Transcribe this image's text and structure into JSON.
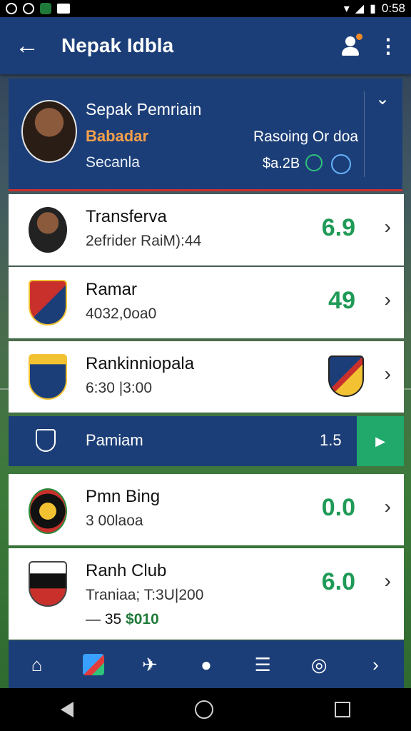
{
  "status_bar": {
    "time": "0:58"
  },
  "app_bar": {
    "title": "Nepak Idbla"
  },
  "profile": {
    "name": "Sepak Pemriain",
    "subtitle": "Babadar",
    "status": "Secanla",
    "rating_label": "Rasoing Or doa",
    "value": "$a.2B"
  },
  "rows": [
    {
      "title": "Transferva",
      "meta": "2efrider RaiM):44",
      "score": "6.9"
    },
    {
      "title": "Ramar",
      "meta": "4032,0oa0",
      "score": "49"
    },
    {
      "title": "Rankinniopala",
      "meta": "6:30 |3:00"
    },
    {
      "title": "Pmn Bing",
      "meta": "3 00laoa",
      "score": "0.0"
    },
    {
      "title": "Ranh Club",
      "meta": "Traniaa;  T:3U|200",
      "score": "6.0",
      "extra_prefix": "— 35",
      "extra_value": "$010"
    }
  ],
  "highlight": {
    "label": "Pamiam",
    "value": "1.5"
  },
  "colors": {
    "primary": "#1c3e78",
    "accent_green": "#21a86b",
    "score_green": "#1f9a57",
    "orange": "#f5a04a"
  },
  "icons": {
    "back": "arrow-left-icon",
    "profile": "person-icon",
    "more": "more-vert-icon",
    "tabs": [
      "home-icon",
      "colorful-app-icon",
      "bird-icon",
      "ball-icon",
      "document-icon",
      "controller-icon",
      "chevron-right-icon"
    ]
  }
}
